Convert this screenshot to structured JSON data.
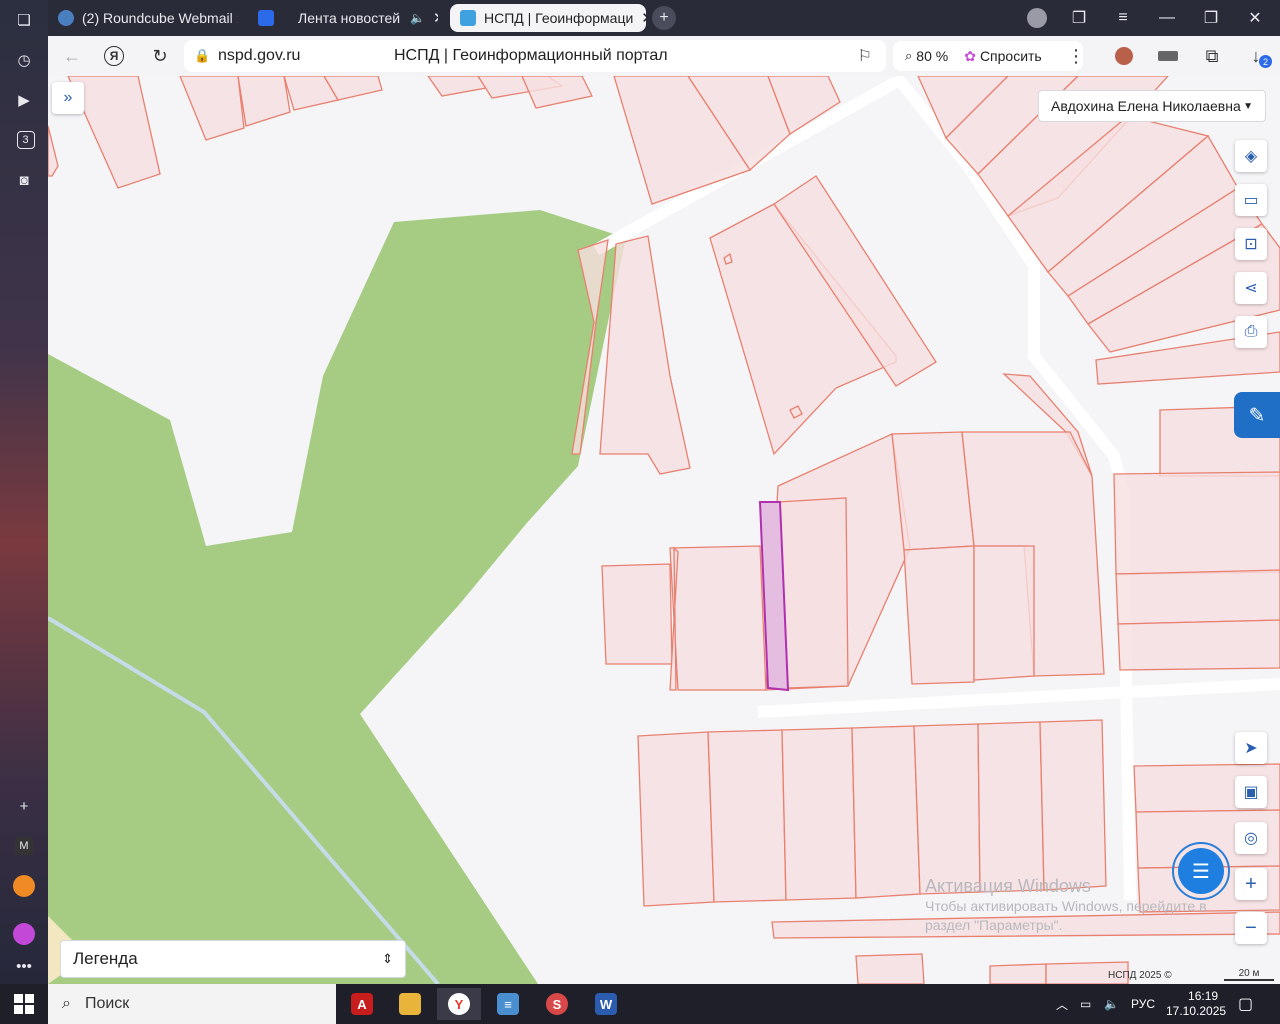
{
  "browser": {
    "tabs": [
      {
        "label": "(2) Roundcube Webmail ::",
        "active": false
      },
      {
        "label": "Лента новостей",
        "active": false,
        "muted_audio": true
      },
      {
        "label": "НСПД | Геоинформаци",
        "active": true
      }
    ],
    "address": {
      "host": "nspd.gov.ru",
      "title": "НСПД | Геоинформационный портал"
    },
    "zoom": "80 %",
    "ask_label": "Спросить",
    "downloads_count": "2",
    "sidebar_badge": "3",
    "sidebar_mail_letter": "M"
  },
  "map": {
    "user_name": "Авдохина Елена Николаевна",
    "legend_label": "Легенда",
    "watermark": {
      "title": "Активация Windows",
      "line1": "Чтобы активировать Windows, перейдите в",
      "line2": "раздел \"Параметры\"."
    },
    "copyright": "НСПД 2025 ©",
    "scale": "20 м",
    "colors": {
      "parcel_fill": "#f6dfe0",
      "parcel_stroke": "#e8806f",
      "forest": "#a6cc84",
      "selected_fill": "#e4bde0",
      "selected_stroke": "#b030b0",
      "road": "#c5dbe8"
    }
  },
  "taskbar": {
    "search_placeholder": "Поиск",
    "language": "РУС",
    "time": "16:19",
    "date": "17.10.2025"
  }
}
